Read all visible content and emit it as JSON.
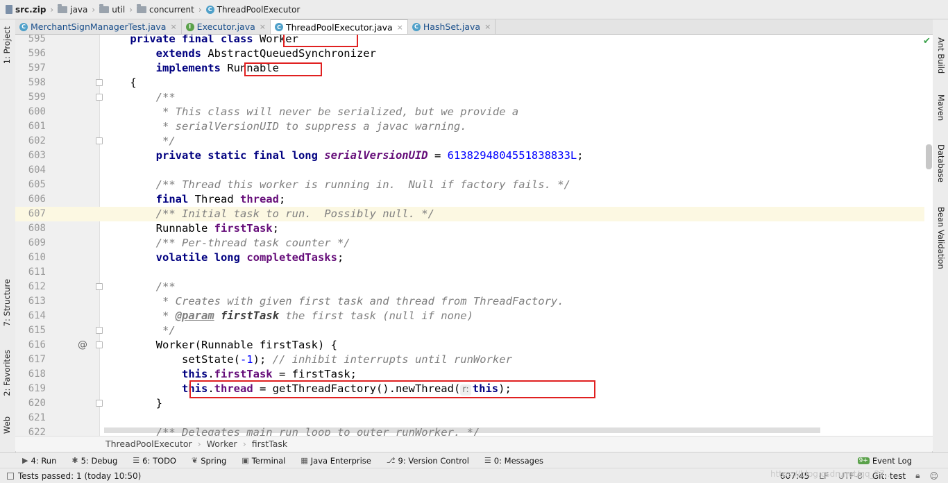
{
  "breadcrumb": {
    "items": [
      {
        "label": "src.zip",
        "icon": "zip-icon"
      },
      {
        "label": "java",
        "icon": "folder-icon"
      },
      {
        "label": "util",
        "icon": "folder-icon"
      },
      {
        "label": "concurrent",
        "icon": "folder-icon"
      },
      {
        "label": "ThreadPoolExecutor",
        "icon": "class-icon"
      }
    ]
  },
  "tabs": [
    {
      "label": "MerchantSignManagerTest.java",
      "icon": "class-icon",
      "active": false
    },
    {
      "label": "Executor.java",
      "icon": "interface-icon",
      "active": false
    },
    {
      "label": "ThreadPoolExecutor.java",
      "icon": "class-icon",
      "active": true
    },
    {
      "label": "HashSet.java",
      "icon": "class-icon",
      "active": false
    }
  ],
  "left_tool_windows": [
    "1: Project",
    "7: Structure",
    "2: Favorites",
    "Web"
  ],
  "right_tool_windows": [
    "Ant Build",
    "Maven",
    "Database",
    "Bean Validation"
  ],
  "code": {
    "current_line": "607",
    "lines": [
      {
        "n": "595",
        "tokens": [
          [
            "    ",
            ""
          ],
          [
            "private final class ",
            "kw"
          ],
          [
            "Worker",
            ""
          ]
        ]
      },
      {
        "n": "596",
        "tokens": [
          [
            "        ",
            ""
          ],
          [
            "extends ",
            "kw"
          ],
          [
            "AbstractQueuedSynchronizer",
            ""
          ]
        ]
      },
      {
        "n": "597",
        "tokens": [
          [
            "        ",
            ""
          ],
          [
            "implements ",
            "kw"
          ],
          [
            "Runnable",
            ""
          ]
        ]
      },
      {
        "n": "598",
        "tokens": [
          [
            "    {",
            ""
          ]
        ]
      },
      {
        "n": "599",
        "tokens": [
          [
            "        ",
            ""
          ],
          [
            "/**",
            "cm"
          ]
        ]
      },
      {
        "n": "600",
        "tokens": [
          [
            "        ",
            ""
          ],
          [
            " * This class will never be serialized, but we provide a",
            "cm"
          ]
        ]
      },
      {
        "n": "601",
        "tokens": [
          [
            "        ",
            ""
          ],
          [
            " * serialVersionUID to suppress a javac warning.",
            "cm"
          ]
        ]
      },
      {
        "n": "602",
        "tokens": [
          [
            "        ",
            ""
          ],
          [
            " */",
            "cm"
          ]
        ]
      },
      {
        "n": "603",
        "tokens": [
          [
            "        ",
            ""
          ],
          [
            "private static final long ",
            "kw"
          ],
          [
            "serialVersionUID",
            "fds"
          ],
          [
            " = ",
            ""
          ],
          [
            "6138294804551838833L",
            "num"
          ],
          [
            ";",
            ""
          ]
        ]
      },
      {
        "n": "604",
        "tokens": [
          [
            "",
            ""
          ]
        ]
      },
      {
        "n": "605",
        "tokens": [
          [
            "        ",
            ""
          ],
          [
            "/** Thread this worker is running in.  Null if factory fails. */",
            "cm"
          ]
        ]
      },
      {
        "n": "606",
        "tokens": [
          [
            "        ",
            ""
          ],
          [
            "final ",
            "kw"
          ],
          [
            "Thread ",
            ""
          ],
          [
            "thread",
            "fd"
          ],
          [
            ";",
            ""
          ]
        ]
      },
      {
        "n": "607",
        "tokens": [
          [
            "        ",
            ""
          ],
          [
            "/** Initial task to run.  Possibly null. */",
            "cm"
          ]
        ]
      },
      {
        "n": "608",
        "tokens": [
          [
            "        Runnable ",
            ""
          ],
          [
            "firstTask",
            "fd"
          ],
          [
            ";",
            ""
          ]
        ]
      },
      {
        "n": "609",
        "tokens": [
          [
            "        ",
            ""
          ],
          [
            "/** Per-thread task counter */",
            "cm"
          ]
        ]
      },
      {
        "n": "610",
        "tokens": [
          [
            "        ",
            ""
          ],
          [
            "volatile long ",
            "kw"
          ],
          [
            "completedTasks",
            "fd"
          ],
          [
            ";",
            ""
          ]
        ]
      },
      {
        "n": "611",
        "tokens": [
          [
            "",
            ""
          ]
        ]
      },
      {
        "n": "612",
        "tokens": [
          [
            "        ",
            ""
          ],
          [
            "/**",
            "cm"
          ]
        ]
      },
      {
        "n": "613",
        "tokens": [
          [
            "        ",
            ""
          ],
          [
            " * Creates with given first task and thread from ThreadFactory.",
            "cm"
          ]
        ]
      },
      {
        "n": "614",
        "tokens": [
          [
            "        ",
            ""
          ],
          [
            " * ",
            "cm"
          ],
          [
            "@param",
            "tag"
          ],
          [
            " ",
            "cm"
          ],
          [
            "firstTask",
            "pn"
          ],
          [
            " the first task (null if none)",
            "cm"
          ]
        ]
      },
      {
        "n": "615",
        "tokens": [
          [
            "        ",
            ""
          ],
          [
            " */",
            "cm"
          ]
        ]
      },
      {
        "n": "616",
        "tokens": [
          [
            "        Worker(Runnable firstTask) {",
            ""
          ]
        ]
      },
      {
        "n": "617",
        "tokens": [
          [
            "            setState(",
            ""
          ],
          [
            "-1",
            "num"
          ],
          [
            "); ",
            ""
          ],
          [
            "// inhibit interrupts until runWorker",
            "cm"
          ]
        ]
      },
      {
        "n": "618",
        "tokens": [
          [
            "            ",
            ""
          ],
          [
            "this",
            "kw"
          ],
          [
            ".",
            ""
          ],
          [
            "firstTask",
            "fd"
          ],
          [
            " = firstTask;",
            ""
          ]
        ]
      },
      {
        "n": "619",
        "tokens": [
          [
            "            ",
            ""
          ],
          [
            "this",
            "kw"
          ],
          [
            ".",
            ""
          ],
          [
            "thread",
            "fd"
          ],
          [
            " = getThreadFactory().newThread(",
            ""
          ],
          [
            "r:",
            "hint"
          ],
          [
            "this",
            "kw"
          ],
          [
            ");",
            ""
          ]
        ]
      },
      {
        "n": "620",
        "tokens": [
          [
            "        }",
            ""
          ]
        ]
      },
      {
        "n": "621",
        "tokens": [
          [
            "",
            ""
          ]
        ]
      },
      {
        "n": "622",
        "tokens": [
          [
            "        ",
            ""
          ],
          [
            "/** Delegates main run loop to outer runWorker. */",
            "cm"
          ]
        ]
      }
    ]
  },
  "code_breadcrumb": [
    "ThreadPoolExecutor",
    "Worker",
    "firstTask"
  ],
  "gutter_marker": "@",
  "tool_windows": [
    {
      "num": "4",
      "label": "4: Run",
      "icon": "run-icon"
    },
    {
      "num": "5",
      "label": "5: Debug",
      "icon": "debug-icon"
    },
    {
      "num": "6",
      "label": "6: TODO",
      "icon": "todo-icon"
    },
    {
      "num": "",
      "label": "Spring",
      "icon": "spring-icon"
    },
    {
      "num": "",
      "label": "Terminal",
      "icon": "terminal-icon"
    },
    {
      "num": "",
      "label": "Java Enterprise",
      "icon": "java-enterprise-icon"
    },
    {
      "num": "9",
      "label": "9: Version Control",
      "icon": "version-control-icon"
    },
    {
      "num": "0",
      "label": "0: Messages",
      "icon": "messages-icon"
    }
  ],
  "event_log": {
    "label": "Event Log",
    "badge": "9+"
  },
  "status": {
    "message": "Tests passed: 1 (today 10:50)",
    "position": "607:45",
    "line_sep": "LF",
    "encoding": "UTF-8",
    "vcs": "Git: test"
  },
  "watermark": "https://blog.csdn.net/qq_27...",
  "colors": {
    "keyword": "#000080",
    "comment": "#7f7f7f",
    "field": "#660e7a",
    "number": "#0000ff",
    "highlight_box": "#e02020",
    "current_line": "#fcf8e2"
  }
}
